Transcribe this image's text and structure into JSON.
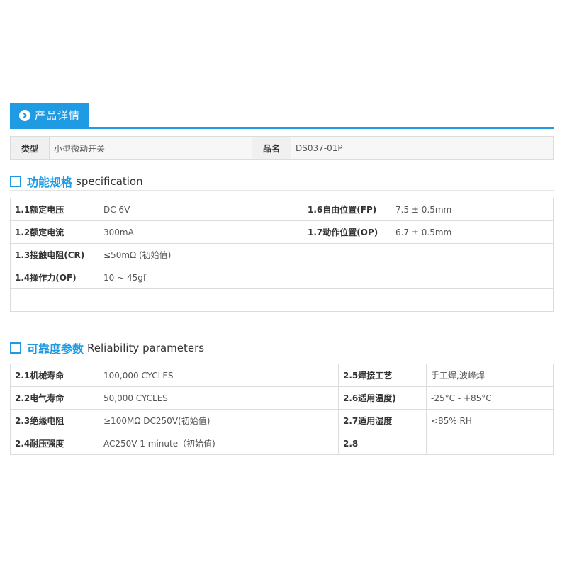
{
  "header": {
    "tab_label": "产品详情"
  },
  "product": {
    "type_label": "类型",
    "type_value": "小型微动开关",
    "name_label": "品名",
    "name_value": "DS037-01P"
  },
  "spec_section": {
    "title_cn": "功能规格",
    "title_en": "specification"
  },
  "spec_rows": [
    {
      "k1": "1.1额定电压",
      "v1": "DC 6V",
      "k2": "1.6自由位置(FP)",
      "v2": "7.5 ± 0.5mm"
    },
    {
      "k1": "1.2额定电流",
      "v1": "300mA",
      "k2": "1.7动作位置(OP)",
      "v2": "6.7 ± 0.5mm"
    },
    {
      "k1": "1.3接触电阻(CR)",
      "v1": "≤50mΩ (初始值)",
      "k2": "",
      "v2": ""
    },
    {
      "k1": "1.4操作力(OF)",
      "v1": "10 ~ 45gf",
      "k2": "",
      "v2": ""
    },
    {
      "k1": "",
      "v1": "",
      "k2": "",
      "v2": ""
    }
  ],
  "rel_section": {
    "title_cn": "可靠度参数",
    "title_en": "Reliability parameters"
  },
  "rel_rows": [
    {
      "k1": "2.1机械寿命",
      "v1": "100,000 CYCLES",
      "k2": "2.5焊接工艺",
      "v2": "手工焊,波峰焊"
    },
    {
      "k1": "2.2电气寿命",
      "v1": "50,000  CYCLES",
      "k2": "2.6适用温度)",
      "v2": "-25°C - +85°C"
    },
    {
      "k1": "2.3绝缘电阻",
      "v1": "≥100MΩ DC250V(初始值)",
      "k2": "2.7适用湿度",
      "v2": "<85% RH"
    },
    {
      "k1": "2.4耐压强度",
      "v1": "AC250V 1 minute（初始值)",
      "k2": "2.8",
      "v2": ""
    }
  ],
  "colors": {
    "accent": "#1e9be3"
  }
}
